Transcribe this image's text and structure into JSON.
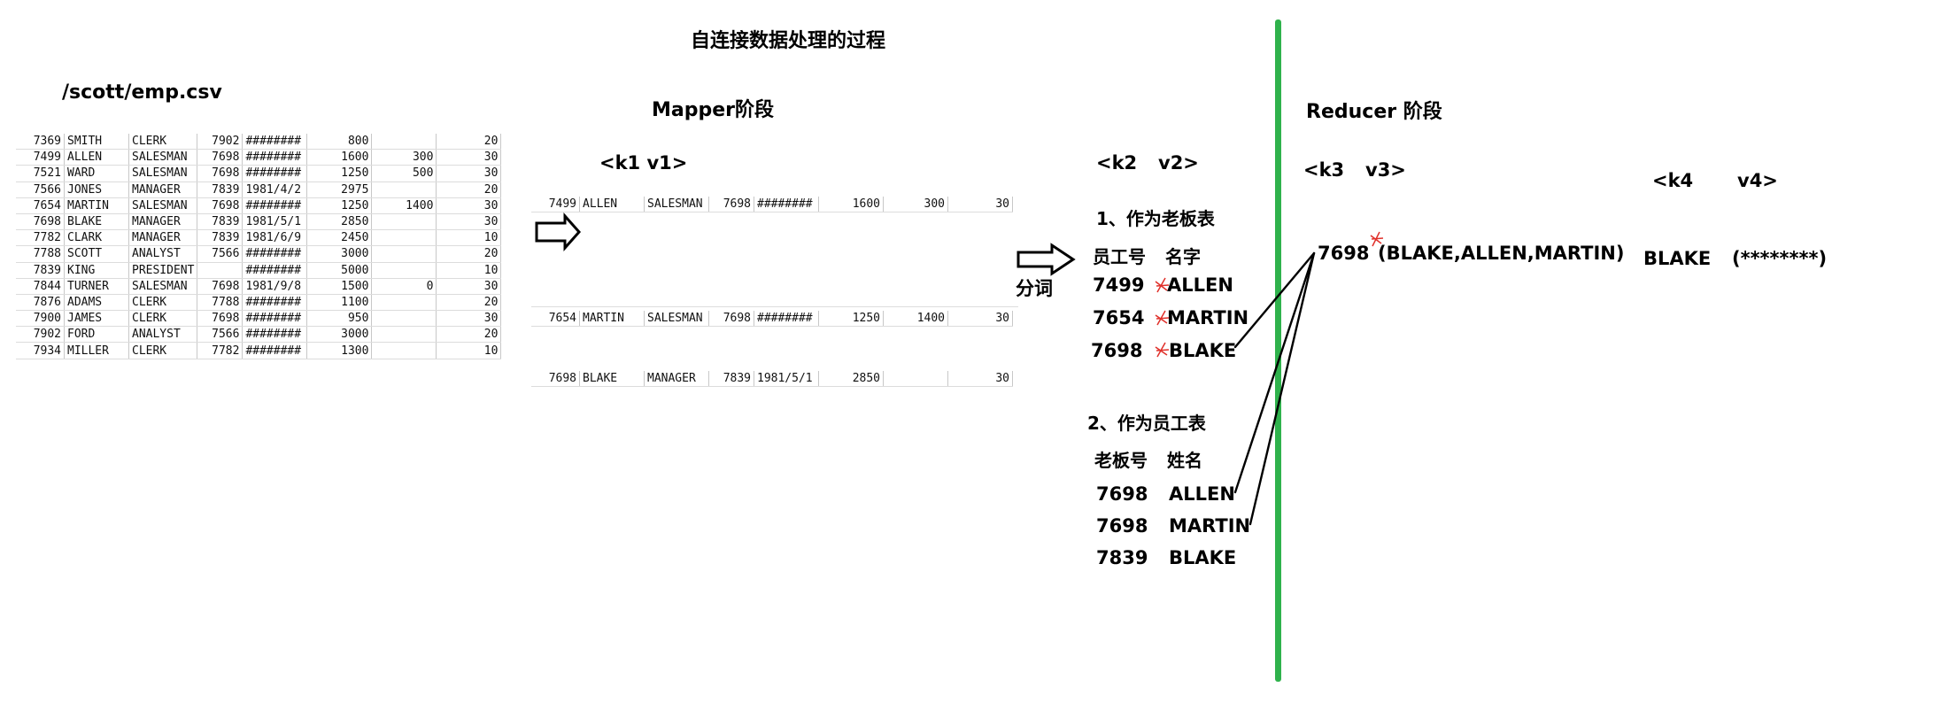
{
  "title": "自连接数据处理的过程",
  "input": {
    "label": "/scott/emp.csv",
    "rows": [
      [
        "7369",
        "SMITH",
        "CLERK",
        "7902",
        "########",
        "800",
        "",
        "20"
      ],
      [
        "7499",
        "ALLEN",
        "SALESMAN",
        "7698",
        "########",
        "1600",
        "300",
        "30"
      ],
      [
        "7521",
        "WARD",
        "SALESMAN",
        "7698",
        "########",
        "1250",
        "500",
        "30"
      ],
      [
        "7566",
        "JONES",
        "MANAGER",
        "7839",
        "1981/4/2",
        "2975",
        "",
        "20"
      ],
      [
        "7654",
        "MARTIN",
        "SALESMAN",
        "7698",
        "########",
        "1250",
        "1400",
        "30"
      ],
      [
        "7698",
        "BLAKE",
        "MANAGER",
        "7839",
        "1981/5/1",
        "2850",
        "",
        "30"
      ],
      [
        "7782",
        "CLARK",
        "MANAGER",
        "7839",
        "1981/6/9",
        "2450",
        "",
        "10"
      ],
      [
        "7788",
        "SCOTT",
        "ANALYST",
        "7566",
        "########",
        "3000",
        "",
        "20"
      ],
      [
        "7839",
        "KING",
        "PRESIDENT",
        "",
        "########",
        "5000",
        "",
        "10"
      ],
      [
        "7844",
        "TURNER",
        "SALESMAN",
        "7698",
        "1981/9/8",
        "1500",
        "0",
        "30"
      ],
      [
        "7876",
        "ADAMS",
        "CLERK",
        "7788",
        "########",
        "1100",
        "",
        "20"
      ],
      [
        "7900",
        "JAMES",
        "CLERK",
        "7698",
        "########",
        "950",
        "",
        "30"
      ],
      [
        "7902",
        "FORD",
        "ANALYST",
        "7566",
        "########",
        "3000",
        "",
        "20"
      ],
      [
        "7934",
        "MILLER",
        "CLERK",
        "7782",
        "########",
        "1300",
        "",
        "10"
      ]
    ]
  },
  "mapper": {
    "label": "Mapper阶段",
    "kv": "<k1 v1>",
    "rows": [
      [
        "7499",
        "ALLEN",
        "SALESMAN",
        "7698",
        "########",
        "1600",
        "300",
        "30"
      ],
      [
        "7654",
        "MARTIN",
        "SALESMAN",
        "7698",
        "########",
        "1250",
        "1400",
        "30"
      ],
      [
        "7698",
        "BLAKE",
        "MANAGER",
        "7839",
        "1981/5/1",
        "2850",
        "",
        "30"
      ]
    ],
    "split_label": "分词",
    "output_kv": [
      "<k2",
      "v2>"
    ],
    "section1": "1、作为老板表",
    "section1_headers": [
      "员工号",
      "名字"
    ],
    "section1_rows": [
      [
        "7499",
        "ALLEN"
      ],
      [
        "7654",
        "MARTIN"
      ],
      [
        "7698",
        "BLAKE"
      ]
    ],
    "section2": "2、作为员工表",
    "section2_headers": [
      "老板号",
      "姓名"
    ],
    "section2_rows": [
      [
        "7698",
        "ALLEN"
      ],
      [
        "7698",
        "MARTIN"
      ],
      [
        "7839",
        "BLAKE"
      ]
    ]
  },
  "reducer": {
    "label": "Reducer 阶段",
    "input_kv": [
      "<k3",
      "v3>"
    ],
    "key": "7698",
    "values": "(BLAKE,ALLEN,MARTIN)",
    "output_kv": [
      "<k4",
      "v4>"
    ],
    "out_key": "BLAKE",
    "out_value": "(********)"
  },
  "colors": {
    "divider": "#2fb24c",
    "star_mark": "#e0302a"
  }
}
